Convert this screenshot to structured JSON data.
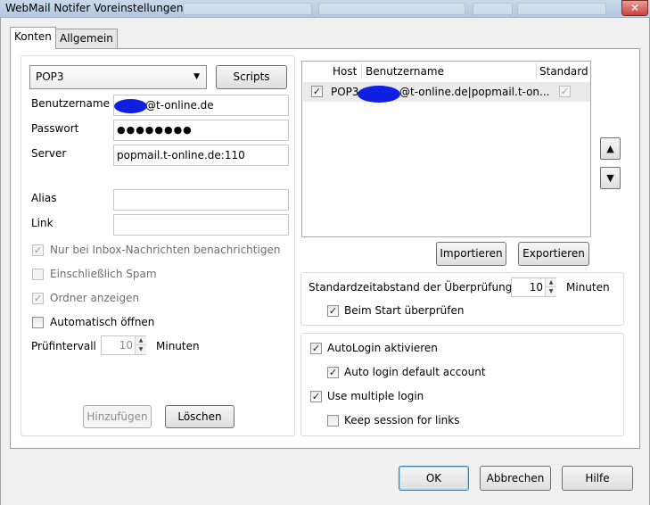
{
  "window": {
    "title": "WebMail Notifer Voreinstellungen",
    "close_glyph": "✕"
  },
  "tabs": [
    {
      "label": "Konten",
      "selected": true
    },
    {
      "label": "Allgemein",
      "selected": false
    }
  ],
  "account": {
    "type_value": "POP3",
    "scripts_label": "Scripts",
    "username_label": "Benutzername",
    "username_value": "@t-online.de",
    "password_label": "Passwort",
    "password_value": "●●●●●●●●",
    "server_label": "Server",
    "server_value": "popmail.t-online.de:110",
    "alias_label": "Alias",
    "alias_value": "",
    "link_label": "Link",
    "link_value": "",
    "options": [
      {
        "label": "Nur bei Inbox-Nachrichten benachrichtigen",
        "checked": true,
        "disabled": true
      },
      {
        "label": "Einschließlich Spam",
        "checked": false,
        "disabled": true
      },
      {
        "label": "Ordner anzeigen",
        "checked": true,
        "disabled": true
      },
      {
        "label": "Automatisch öffnen",
        "checked": false,
        "disabled": false
      }
    ],
    "interval_label": "Prüfintervall",
    "interval_value": "10",
    "interval_unit": "Minuten",
    "add_label": "Hinzufügen",
    "delete_label": "Löschen"
  },
  "accounts_list": {
    "columns": [
      "Host",
      "Benutzername",
      "Standard"
    ],
    "rows": [
      {
        "checked": true,
        "host": "POP3",
        "username": "@t-online.de|popmail.t-on...",
        "standard": true
      }
    ]
  },
  "import_label": "Importieren",
  "export_label": "Exportieren",
  "check": {
    "interval_label": "Standardzeitabstand der Überprüfung",
    "interval_value": "10",
    "interval_unit": "Minuten",
    "on_start_label": "Beim Start überprüfen",
    "on_start_checked": true
  },
  "autologin": {
    "enable_label": "AutoLogin aktivieren",
    "default_account_label": "Auto login default account",
    "multiple_label": "Use multiple login",
    "keep_session_label": "Keep session for links"
  },
  "footer": {
    "ok_label": "OK",
    "cancel_label": "Abbrechen",
    "help_label": "Hilfe"
  },
  "glyphs": {
    "check": "✓",
    "dropdown": "▼",
    "spin_up": "▲",
    "spin_down": "▼",
    "move_up": "▲",
    "move_down": "▼"
  }
}
